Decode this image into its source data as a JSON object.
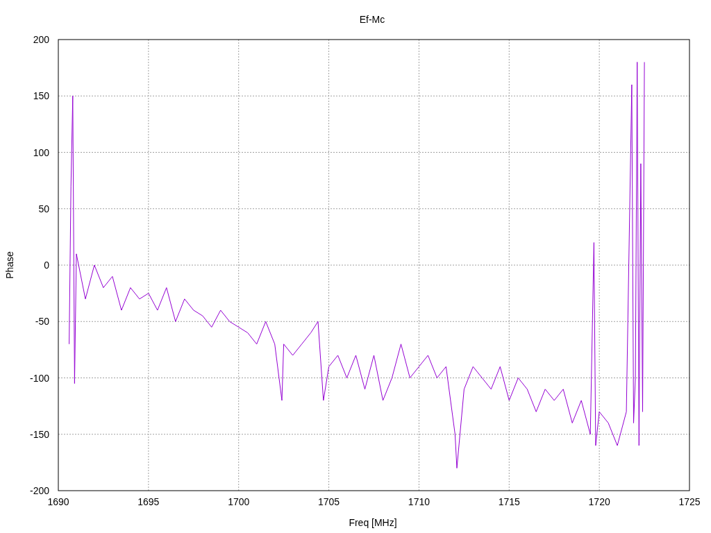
{
  "chart_data": {
    "type": "line",
    "grid": true,
    "title": "Ef-Mc",
    "xlabel": "Freq [MHz]",
    "ylabel": "Phase",
    "xlim": [
      1690,
      1725
    ],
    "ylim": [
      -200,
      200
    ],
    "xticks": [
      1690,
      1695,
      1700,
      1705,
      1710,
      1715,
      1720,
      1725
    ],
    "yticks": [
      -200,
      -150,
      -100,
      -50,
      0,
      50,
      100,
      150,
      200
    ],
    "x": [
      1690.6,
      1690.7,
      1690.8,
      1690.9,
      1691,
      1691.5,
      1692,
      1692.5,
      1693,
      1693.5,
      1694,
      1694.5,
      1695,
      1695.5,
      1696,
      1696.5,
      1697,
      1697.5,
      1698,
      1698.5,
      1699,
      1699.5,
      1700,
      1700.5,
      1701,
      1701.5,
      1702,
      1702.4,
      1702.5,
      1703,
      1703.5,
      1704,
      1704.4,
      1704.7,
      1705,
      1705.5,
      1706,
      1706.5,
      1707,
      1707.5,
      1708,
      1708.5,
      1709,
      1709.5,
      1710,
      1710.5,
      1711,
      1711.5,
      1712,
      1712.1,
      1712.5,
      1713,
      1713.5,
      1714,
      1714.5,
      1715,
      1715.5,
      1716,
      1716.5,
      1717,
      1717.5,
      1718,
      1718.5,
      1719,
      1719.5,
      1719.7,
      1719.8,
      1720,
      1720.5,
      1721,
      1721.5,
      1721.8,
      1721.9,
      1722,
      1722.1,
      1722.2,
      1722.3,
      1722.4,
      1722.5
    ],
    "series": [
      {
        "color": "#9400d3",
        "values": [
          -70,
          70,
          150,
          -105,
          10,
          -30,
          0,
          -20,
          -10,
          -40,
          -20,
          -30,
          -25,
          -40,
          -20,
          -50,
          -30,
          -40,
          -45,
          -55,
          -40,
          -50,
          -55,
          -60,
          -70,
          -50,
          -70,
          -120,
          -70,
          -80,
          -70,
          -60,
          -50,
          -120,
          -90,
          -80,
          -100,
          -80,
          -110,
          -80,
          -120,
          -100,
          -70,
          -100,
          -90,
          -80,
          -100,
          -90,
          -150,
          -180,
          -110,
          -90,
          -100,
          -110,
          -90,
          -120,
          -100,
          -110,
          -130,
          -110,
          -120,
          -110,
          -140,
          -120,
          -150,
          20,
          -160,
          -130,
          -140,
          -160,
          -130,
          160,
          -140,
          -100,
          180,
          -160,
          90,
          -130,
          180
        ]
      }
    ]
  }
}
